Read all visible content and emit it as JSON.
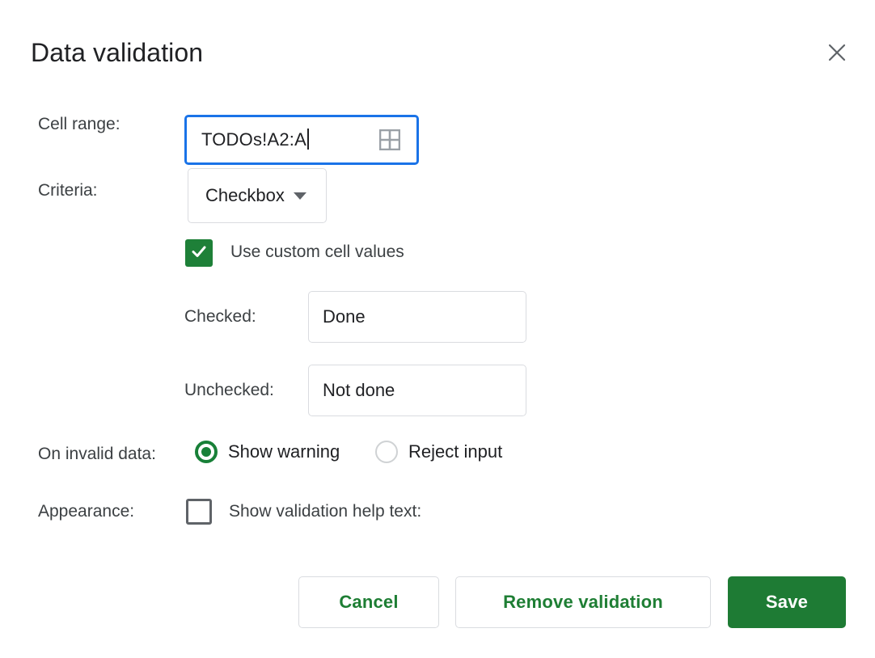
{
  "dialog": {
    "title": "Data validation",
    "close_icon": "close-icon"
  },
  "fields": {
    "cell_range": {
      "label": "Cell range:",
      "value": "TODOs!A2:A",
      "picker_icon": "grid-picker-icon"
    },
    "criteria": {
      "label": "Criteria:",
      "selected": "Checkbox",
      "caret_icon": "chevron-down-icon"
    },
    "custom_values": {
      "label": "Use custom cell values",
      "checked": true,
      "check_icon": "checkmark-icon"
    },
    "checked_value": {
      "label": "Checked:",
      "value": "Done"
    },
    "unchecked_value": {
      "label": "Unchecked:",
      "value": "Not done"
    },
    "on_invalid_data": {
      "label": "On invalid data:",
      "options": [
        {
          "label": "Show warning",
          "selected": true
        },
        {
          "label": "Reject input",
          "selected": false
        }
      ]
    },
    "appearance": {
      "label": "Appearance:",
      "help_text_label": "Show validation help text:",
      "checked": false
    }
  },
  "footer": {
    "cancel_label": "Cancel",
    "remove_label": "Remove validation",
    "save_label": "Save"
  },
  "colors": {
    "accent_green": "#1e7b34",
    "focus_blue": "#1a73e8",
    "checkbox_green": "#1e8038",
    "radio_green": "#188038",
    "border_gray": "#dadce0",
    "text_primary": "#202124",
    "text_secondary": "#3c4043"
  }
}
